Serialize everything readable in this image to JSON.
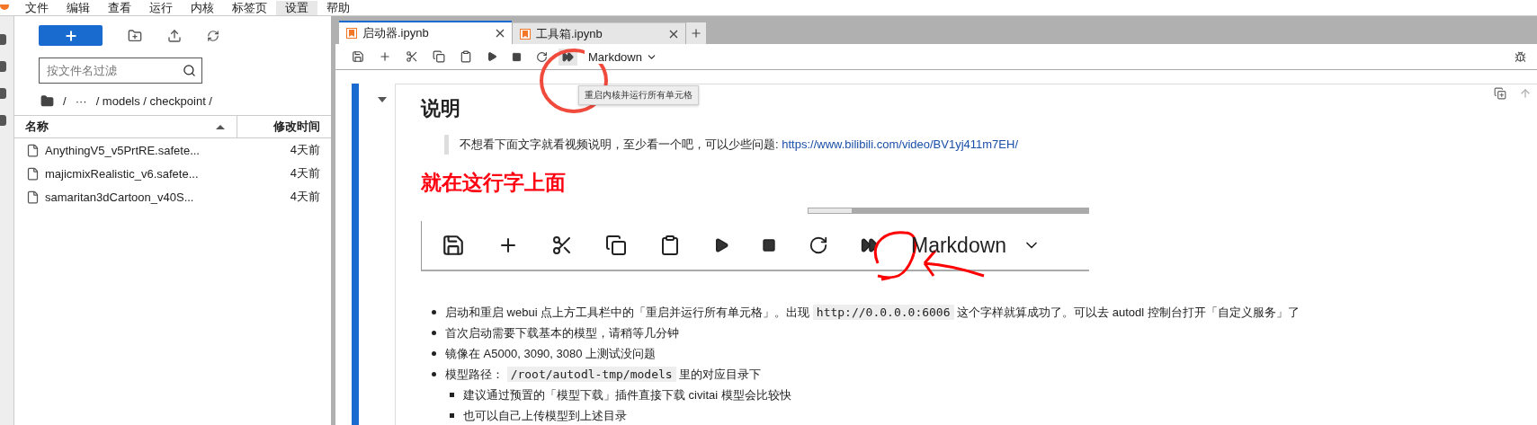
{
  "menu": [
    {
      "label": "文件",
      "selected": false
    },
    {
      "label": "编辑",
      "selected": false
    },
    {
      "label": "查看",
      "selected": false
    },
    {
      "label": "运行",
      "selected": false
    },
    {
      "label": "内核",
      "selected": false
    },
    {
      "label": "标签页",
      "selected": false
    },
    {
      "label": "设置",
      "selected": true
    },
    {
      "label": "帮助",
      "selected": false
    }
  ],
  "file_browser": {
    "filter": {
      "placeholder": "按文件名过滤"
    },
    "breadcrumb": [
      "/",
      "···",
      "/ models / checkpoint /"
    ],
    "columns": [
      {
        "label": "名称",
        "sorted": true
      },
      {
        "label": "修改时间",
        "sorted": false
      }
    ],
    "files": [
      {
        "name": "AnythingV5_v5PrtRE.safete...",
        "modified": "4天前"
      },
      {
        "name": "majicmixRealistic_v6.safete...",
        "modified": "4天前"
      },
      {
        "name": "samaritan3dCartoon_v40S...",
        "modified": "4天前"
      }
    ]
  },
  "tabs": [
    {
      "title": "启动器.ipynb",
      "selected": true
    },
    {
      "title": "工具箱.ipynb",
      "selected": false
    }
  ],
  "toolbar": {
    "cell_type": "Markdown",
    "tooltip": "重启内核并运行所有单元格"
  },
  "cell": {
    "heading": "说明",
    "quote": {
      "text": "不想看下面文字就看视频说明，至少看一个吧，可以少些问题: ",
      "link": "https://www.bilibili.com/video/BV1yj411m7EH/"
    },
    "red_note": "就在这行字上面",
    "embedded_toolbar": {
      "cell_type": "Markdown"
    },
    "bullets": [
      {
        "parts": [
          {
            "kind": "text",
            "text": "启动和重启 webui 点上方工具栏中的「重启并运行所有单元格」。出现 "
          },
          {
            "kind": "code",
            "text": "http://0.0.0.0:6006"
          },
          {
            "kind": "text",
            "text": " 这个字样就算成功了。可以去 autodl 控制台打开「自定义服务」了"
          }
        ]
      },
      {
        "parts": [
          {
            "kind": "text",
            "text": "首次启动需要下载基本的模型，请稍等几分钟"
          }
        ]
      },
      {
        "parts": [
          {
            "kind": "text",
            "text": "镜像在 A5000, 3090, 3080 上测试没问题"
          }
        ]
      },
      {
        "parts": [
          {
            "kind": "text",
            "text": "模型路径： "
          },
          {
            "kind": "code",
            "text": "/root/autodl-tmp/models"
          },
          {
            "kind": "text",
            "text": " 里的对应目录下"
          }
        ],
        "children": [
          {
            "parts": [
              {
                "kind": "text",
                "text": "建议通过预置的「模型下载」插件直接下载 civitai 模型会比较快"
              }
            ]
          },
          {
            "parts": [
              {
                "kind": "text",
                "text": "也可以自己上传模型到上述目录"
              }
            ]
          }
        ]
      }
    ]
  }
}
